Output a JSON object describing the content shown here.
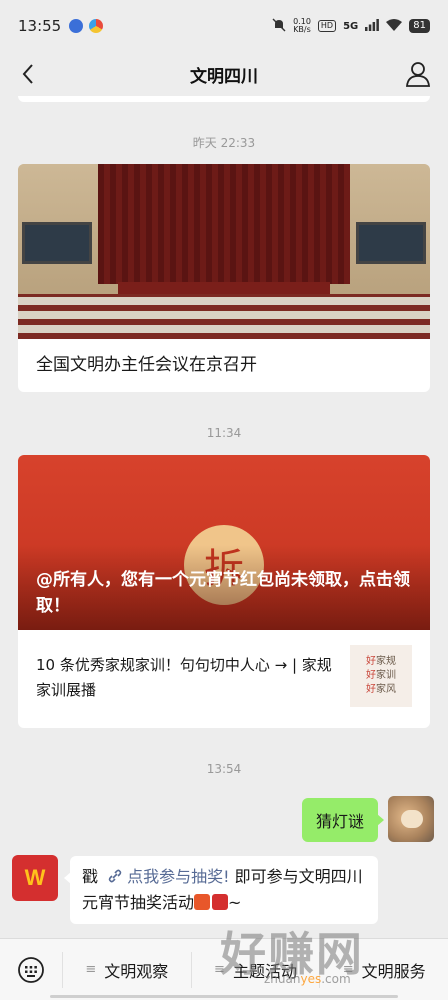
{
  "status_bar": {
    "time": "13:55",
    "net_speed_value": "0.10",
    "net_speed_unit": "KB/s",
    "hd_badge": "HD",
    "signal": "5G",
    "battery": "81"
  },
  "nav": {
    "title": "文明四川",
    "back_icon": "chevron-left-icon",
    "profile_icon": "person-icon"
  },
  "messages": {
    "ts1": "昨天 22:33",
    "article1_title": "全国文明办主任会议在京召开",
    "ts2": "11:34",
    "banner_coin": "拆",
    "article2_headline": "@所有人，您有一个元宵节红包尚未领取，点击领取！",
    "article2_sub": "10 条优秀家规家训！句句切中人心 → | 家规家训展播",
    "thumb_lines": [
      "好",
      "家",
      "规",
      "好",
      "家",
      "训",
      "好",
      "家",
      "风"
    ],
    "ts3": "13:54",
    "my_message": "猜灯谜",
    "bot_prefix": "戳",
    "bot_link": "点我参与抽奖!",
    "bot_rest": "即可参与文明四川元宵节抽奖活动",
    "bot_tail": "~"
  },
  "bottom_menu": {
    "tab1": "文明观察",
    "tab2": "主题活动",
    "tab3": "文明服务"
  },
  "watermark": {
    "big": "好赚网",
    "small_a": "zhuan",
    "small_b": "yes",
    "small_c": ".com"
  },
  "colors": {
    "bubble_green": "#95ec69",
    "link_blue": "#576b95",
    "banner_red": "#d7422c"
  }
}
